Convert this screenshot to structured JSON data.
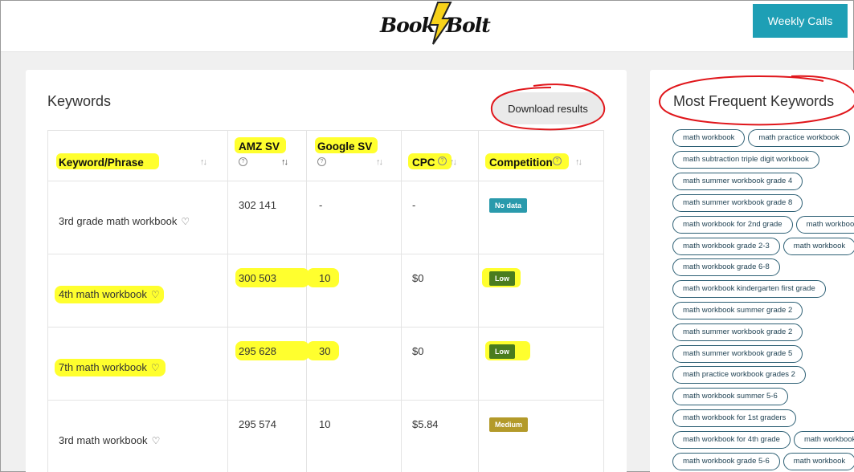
{
  "header": {
    "logo_text_left": "Book",
    "logo_text_right": "Bolt",
    "weekly_calls_label": "Weekly Calls"
  },
  "keywords_panel": {
    "title": "Keywords",
    "download_label": "Download results",
    "columns": [
      {
        "label": "Keyword/Phrase"
      },
      {
        "label": "AMZ SV"
      },
      {
        "label": "Google SV"
      },
      {
        "label": "CPC"
      },
      {
        "label": "Competition"
      }
    ],
    "rows": [
      {
        "keyword": "3rd grade math workbook",
        "amz_sv": "302 141",
        "google_sv": "-",
        "cpc": "-",
        "competition": "No data",
        "competition_color": "#2a9aac",
        "highlighted": false
      },
      {
        "keyword": "4th math workbook",
        "amz_sv": "300 503",
        "google_sv": "10",
        "cpc": "$0",
        "competition": "Low",
        "competition_color": "#4a7c1e",
        "highlighted": true
      },
      {
        "keyword": "7th math workbook",
        "amz_sv": "295 628",
        "google_sv": "30",
        "cpc": "$0",
        "competition": "Low",
        "competition_color": "#4a7c1e",
        "highlighted": true
      },
      {
        "keyword": "3rd math workbook",
        "amz_sv": "295 574",
        "google_sv": "10",
        "cpc": "$5.84",
        "competition": "Medium",
        "competition_color": "#b39a2a",
        "highlighted": false
      }
    ]
  },
  "frequent_panel": {
    "title": "Most Frequent Keywords",
    "chips": [
      [
        "math workbook",
        "math practice workbook"
      ],
      [
        "math subtraction triple digit workbook"
      ],
      [
        "math summer workbook grade 4"
      ],
      [
        "math summer workbook grade 8"
      ],
      [
        "math workbook for 2nd grade",
        "math workbook"
      ],
      [
        "math workbook grade 2-3",
        "math workbook"
      ],
      [
        "math workbook grade 6-8"
      ],
      [
        "math workbook kindergarten first grade"
      ],
      [
        "math workbook summer grade 2"
      ],
      [
        "math summer workbook grade 2"
      ],
      [
        "math summer workbook grade 5"
      ],
      [
        "math practice workbook grades 2"
      ],
      [
        "math workbook summer 5-6"
      ],
      [
        "math workbook for 1st graders"
      ],
      [
        "math workbook for 4th grade",
        "math workbook"
      ],
      [
        "math workbook grade 5-6",
        "math workbook"
      ]
    ]
  },
  "colors": {
    "accent": "#1e9fb5",
    "highlight": "#ffff2e",
    "annotation": "#e0161b"
  }
}
